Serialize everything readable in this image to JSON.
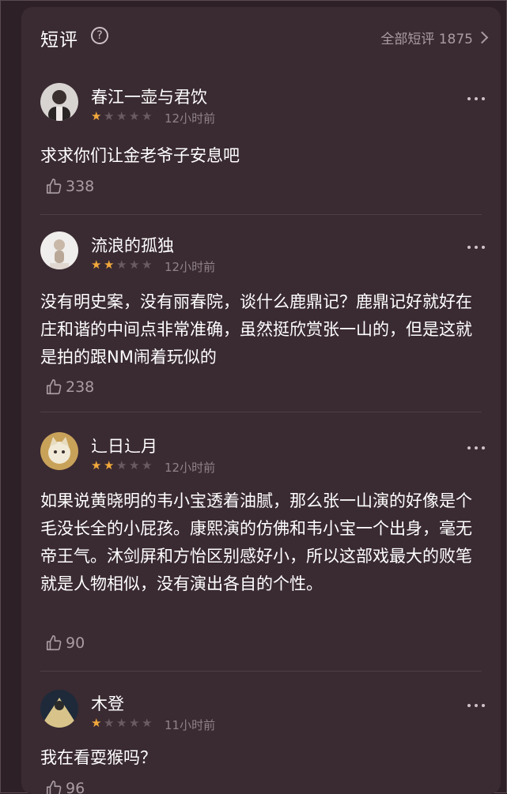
{
  "header": {
    "title": "短评",
    "all_label": "全部短评 1875"
  },
  "comments": [
    {
      "user": "春江一壶与君饮",
      "rating": 1,
      "time": "12小时前",
      "text": "求求你们让金老爷子安息吧",
      "likes": "338"
    },
    {
      "user": "流浪的孤独",
      "rating": 2,
      "time": "12小时前",
      "text": "没有明史案，没有丽春院，谈什么鹿鼎记？鹿鼎记好就好在庄和谐的中间点非常准确，虽然挺欣赏张一山的，但是这就是拍的跟NM闹着玩似的",
      "likes": "238"
    },
    {
      "user": "辶日辶月",
      "rating": 2,
      "time": "12小时前",
      "text": "如果说黄晓明的韦小宝透着油腻，那么张一山演的好像是个毛没长全的小屁孩。康熙演的仿佛和韦小宝一个出身，毫无帝王气。沐剑屏和方怡区别感好小，所以这部戏最大的败笔就是人物相似，没有演出各自的个性。",
      "likes": "90"
    },
    {
      "user": "木登",
      "rating": 1,
      "time": "11小时前",
      "text": "我在看耍猴吗？",
      "likes": "96"
    }
  ],
  "colors": {
    "background": "#3a2a32",
    "star_on": "#f2a93b",
    "star_off": "#6a5a62",
    "muted": "#a99ca2"
  },
  "icons": [
    "help-circle-icon",
    "chevron-right-icon",
    "more-dots-icon",
    "thumbs-up-icon"
  ]
}
